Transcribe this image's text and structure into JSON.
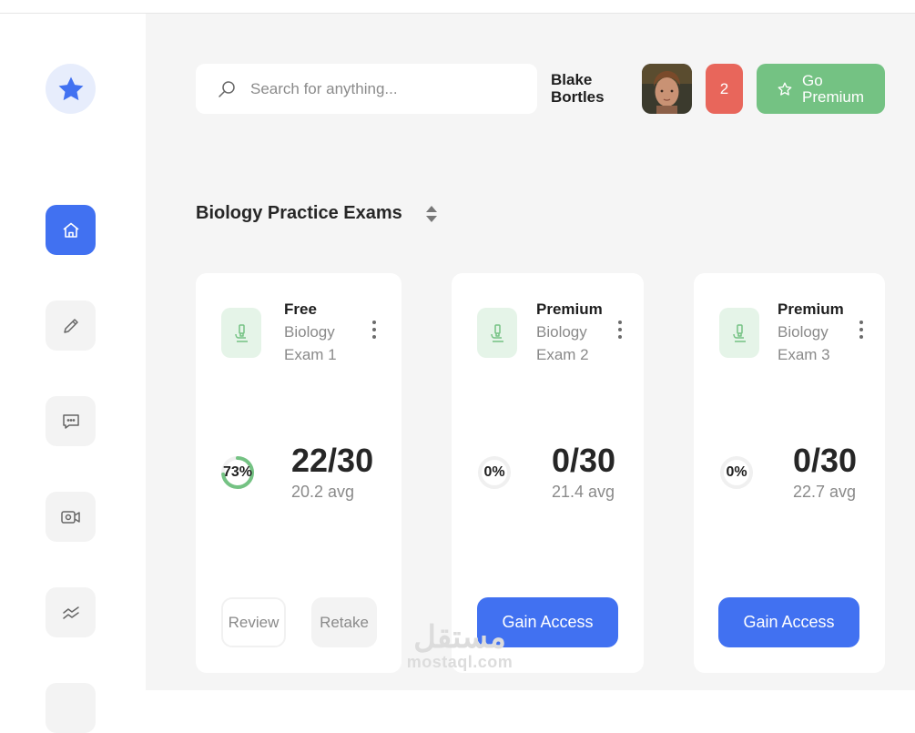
{
  "user": {
    "name": "Blake Bortles",
    "notifications": "2"
  },
  "search": {
    "placeholder": "Search for anything..."
  },
  "header": {
    "premium_label": "Go Premium"
  },
  "section": {
    "title": "Biology Practice Exams"
  },
  "sidebar": {
    "items": [
      {
        "name": "home",
        "icon": "home-icon",
        "active": true
      },
      {
        "name": "edit",
        "icon": "pencil-icon",
        "active": false
      },
      {
        "name": "messages",
        "icon": "chat-icon",
        "active": false
      },
      {
        "name": "video",
        "icon": "video-icon",
        "active": false
      },
      {
        "name": "analytics",
        "icon": "trend-icon",
        "active": false
      }
    ]
  },
  "cards": [
    {
      "tier": "Free",
      "subject": "Biology",
      "exam": "Exam 1",
      "percent_label": "73%",
      "percent": 73,
      "score": "22/30",
      "avg": "20.2 avg",
      "review_label": "Review",
      "retake_label": "Retake"
    },
    {
      "tier": "Premium",
      "subject": "Biology",
      "exam": "Exam 2",
      "percent_label": "0%",
      "percent": 0,
      "score": "0/30",
      "avg": "21.4 avg",
      "action_label": "Gain Access"
    },
    {
      "tier": "Premium",
      "subject": "Biology",
      "exam": "Exam 3",
      "percent_label": "0%",
      "percent": 0,
      "score": "0/30",
      "avg": "22.7 avg",
      "action_label": "Gain Access"
    }
  ],
  "watermark": {
    "arabic": "مستقل",
    "latin": "mostaql.com"
  },
  "colors": {
    "accent": "#4171f1",
    "premium": "#74c283",
    "notification": "#e8665b",
    "icon_bg": "#e5f4e8",
    "progress": "#74c283"
  }
}
